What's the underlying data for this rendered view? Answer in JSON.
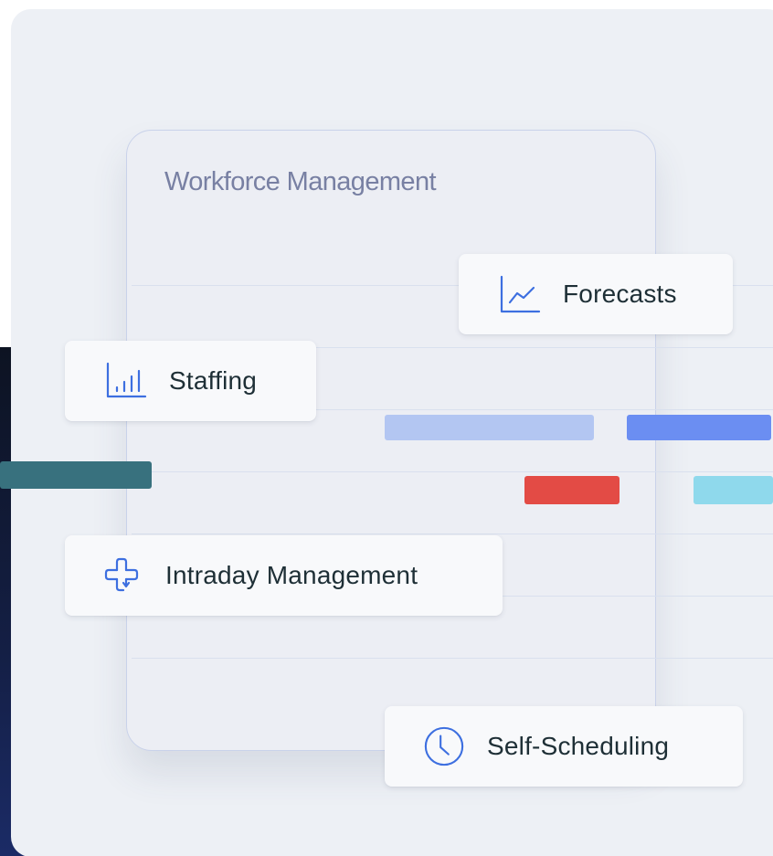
{
  "card": {
    "title": "Workforce Management"
  },
  "features": [
    {
      "label": "Forecasts",
      "icon": "line-chart-icon"
    },
    {
      "label": "Staffing",
      "icon": "bar-chart-icon"
    },
    {
      "label": "Intraday Management",
      "icon": "intraday-arrows-icon"
    },
    {
      "label": "Self-Scheduling",
      "icon": "clock-icon"
    }
  ],
  "colors": {
    "accent": "#3d6fe0",
    "bar_light_blue": "#b3c6f2",
    "bar_blue": "#6b8ef2",
    "bar_teal": "#38717e",
    "bar_red": "#e34b45",
    "bar_cyan": "#8fd9ec"
  }
}
